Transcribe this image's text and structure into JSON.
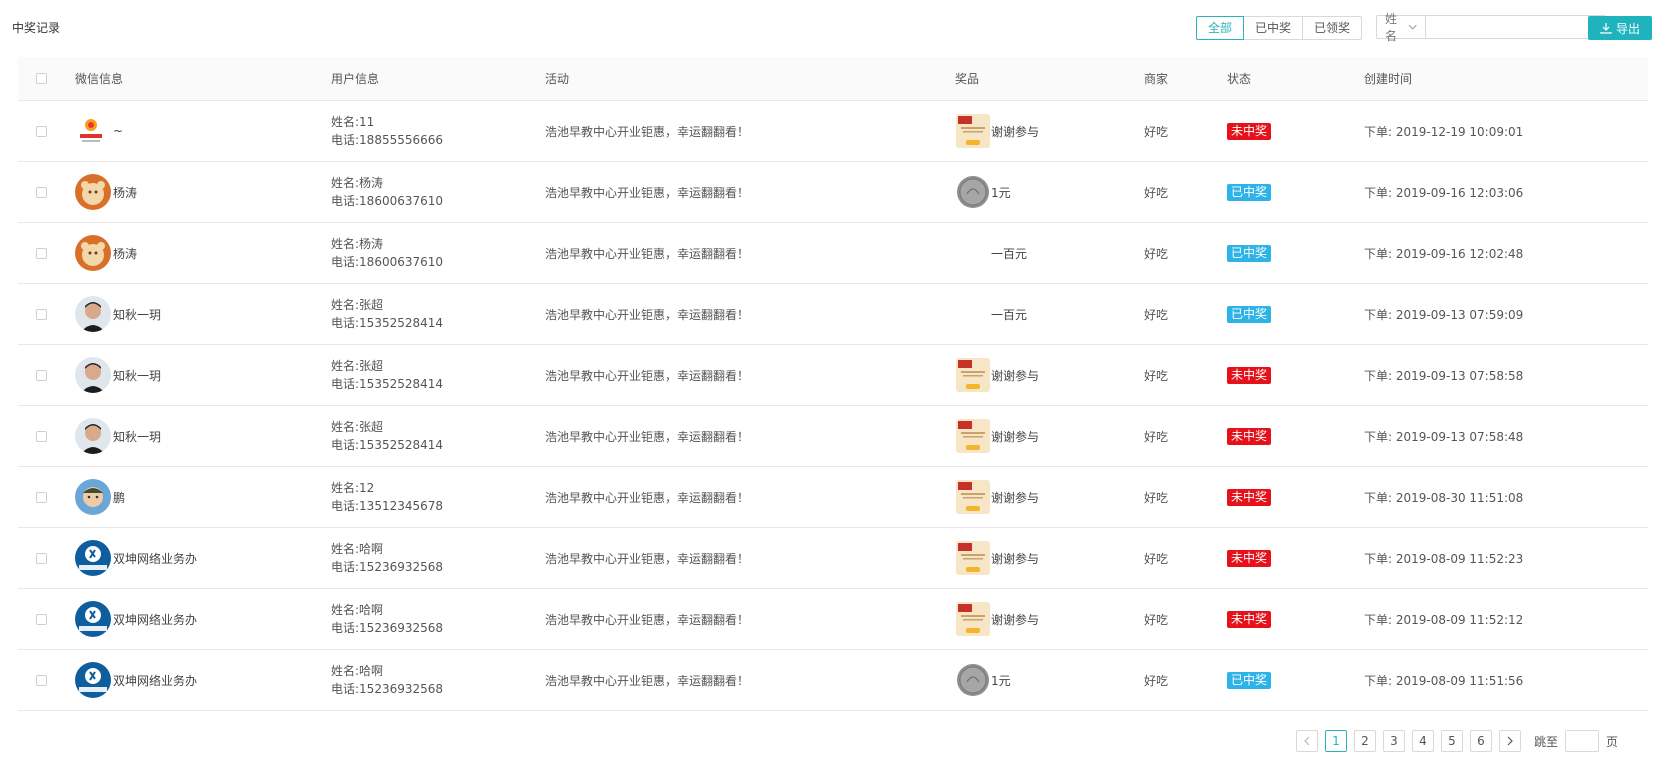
{
  "page": {
    "title": "中奖记录"
  },
  "filters": {
    "tabs": [
      {
        "label": "全部",
        "active": true
      },
      {
        "label": "已中奖",
        "active": false
      },
      {
        "label": "已领奖",
        "active": false
      }
    ],
    "search_field": "姓名",
    "search_value": "",
    "export_label": "导出",
    "accent": "#1fb3bd"
  },
  "table": {
    "headers": {
      "wechat": "微信信息",
      "user": "用户信息",
      "activity": "活动",
      "prize": "奖品",
      "merchant": "商家",
      "status": "状态",
      "created": "创建时间"
    },
    "rows": [
      {
        "avatar": "logo",
        "nickname": "~",
        "name": "姓名:11",
        "phone": "电话:18855556666",
        "activity": "浩池早教中心开业钜惠，幸运翻翻看！",
        "prize_icon": "envelope",
        "prize": "谢谢参与",
        "merchant": "好吃",
        "status": "未中奖",
        "status_type": "lose",
        "time": "下单: 2019-12-19 10:09:01"
      },
      {
        "avatar": "bear",
        "nickname": "杨涛",
        "name": "姓名:杨涛",
        "phone": "电话:18600637610",
        "activity": "浩池早教中心开业钜惠，幸运翻翻看！",
        "prize_icon": "coin",
        "prize": "1元",
        "merchant": "好吃",
        "status": "已中奖",
        "status_type": "win",
        "time": "下单: 2019-09-16 12:03:06"
      },
      {
        "avatar": "bear",
        "nickname": "杨涛",
        "name": "姓名:杨涛",
        "phone": "电话:18600637610",
        "activity": "浩池早教中心开业钜惠，幸运翻翻看！",
        "prize_icon": "none",
        "prize": "一百元",
        "merchant": "好吃",
        "status": "已中奖",
        "status_type": "win",
        "time": "下单: 2019-09-16 12:02:48"
      },
      {
        "avatar": "man",
        "nickname": "知秋一玥",
        "name": "姓名:张超",
        "phone": "电话:15352528414",
        "activity": "浩池早教中心开业钜惠，幸运翻翻看！",
        "prize_icon": "none",
        "prize": "一百元",
        "merchant": "好吃",
        "status": "已中奖",
        "status_type": "win",
        "time": "下单: 2019-09-13 07:59:09"
      },
      {
        "avatar": "man",
        "nickname": "知秋一玥",
        "name": "姓名:张超",
        "phone": "电话:15352528414",
        "activity": "浩池早教中心开业钜惠，幸运翻翻看！",
        "prize_icon": "envelope",
        "prize": "谢谢参与",
        "merchant": "好吃",
        "status": "未中奖",
        "status_type": "lose",
        "time": "下单: 2019-09-13 07:58:58"
      },
      {
        "avatar": "man",
        "nickname": "知秋一玥",
        "name": "姓名:张超",
        "phone": "电话:15352528414",
        "activity": "浩池早教中心开业钜惠，幸运翻翻看！",
        "prize_icon": "envelope",
        "prize": "谢谢参与",
        "merchant": "好吃",
        "status": "未中奖",
        "status_type": "lose",
        "time": "下单: 2019-09-13 07:58:48"
      },
      {
        "avatar": "kid",
        "nickname": "鹏",
        "name": "姓名:12",
        "phone": "电话:13512345678",
        "activity": "浩池早教中心开业钜惠，幸运翻翻看！",
        "prize_icon": "envelope",
        "prize": "谢谢参与",
        "merchant": "好吃",
        "status": "未中奖",
        "status_type": "lose",
        "time": "下单: 2019-08-30 11:51:08"
      },
      {
        "avatar": "brand",
        "nickname": "双坤网络业务办",
        "name": "姓名:哈啊",
        "phone": "电话:15236932568",
        "activity": "浩池早教中心开业钜惠，幸运翻翻看！",
        "prize_icon": "envelope",
        "prize": "谢谢参与",
        "merchant": "好吃",
        "status": "未中奖",
        "status_type": "lose",
        "time": "下单: 2019-08-09 11:52:23"
      },
      {
        "avatar": "brand",
        "nickname": "双坤网络业务办",
        "name": "姓名:哈啊",
        "phone": "电话:15236932568",
        "activity": "浩池早教中心开业钜惠，幸运翻翻看！",
        "prize_icon": "envelope",
        "prize": "谢谢参与",
        "merchant": "好吃",
        "status": "未中奖",
        "status_type": "lose",
        "time": "下单: 2019-08-09 11:52:12"
      },
      {
        "avatar": "brand",
        "nickname": "双坤网络业务办",
        "name": "姓名:哈啊",
        "phone": "电话:15236932568",
        "activity": "浩池早教中心开业钜惠，幸运翻翻看！",
        "prize_icon": "coin",
        "prize": "1元",
        "merchant": "好吃",
        "status": "已中奖",
        "status_type": "win",
        "time": "下单: 2019-08-09 11:51:56"
      }
    ]
  },
  "pagination": {
    "pages": [
      "1",
      "2",
      "3",
      "4",
      "5",
      "6"
    ],
    "current": "1",
    "jump_label": "跳至",
    "page_suffix": "页"
  },
  "colors": {
    "lose": "#e5121b",
    "win": "#2eb3e8"
  }
}
